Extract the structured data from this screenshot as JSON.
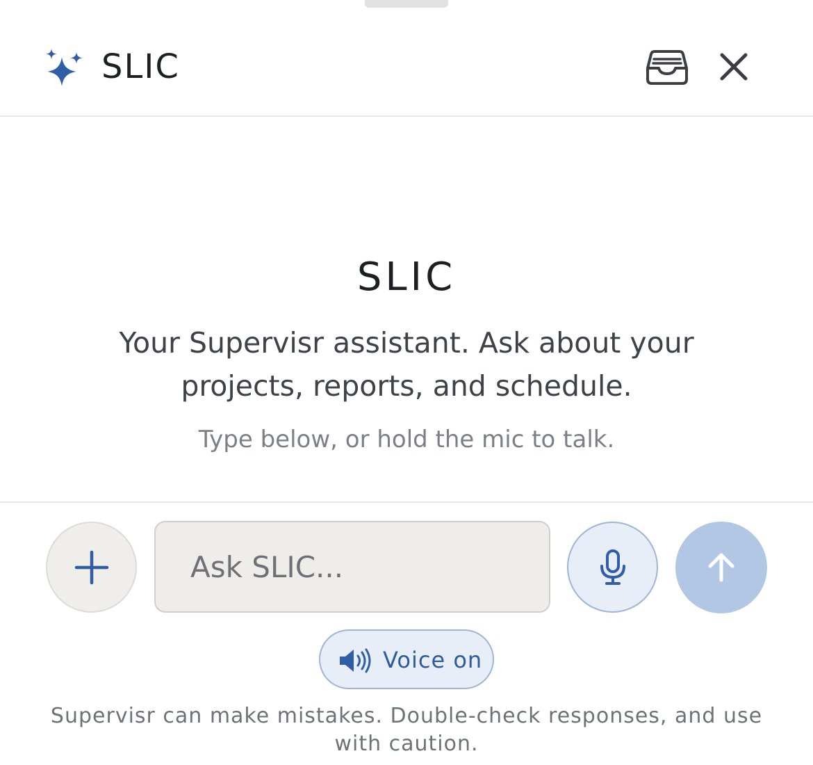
{
  "header": {
    "title": "SLIC",
    "icons": {
      "logo": "sparkles-icon",
      "inbox": "inbox-tray-icon",
      "close": "close-icon"
    },
    "accent": "#2f5ea6"
  },
  "hero": {
    "title": "SLIC",
    "description": "Your Supervisr assistant. Ask about your projects, reports, and schedule.",
    "hint": "Type below, or hold the mic to talk."
  },
  "composer": {
    "placeholder": "Ask SLIC...",
    "value": "",
    "icons": {
      "add": "plus-icon",
      "mic": "microphone-icon",
      "send": "arrow-up-icon"
    },
    "send_enabled": false
  },
  "voice": {
    "label": "Voice on",
    "icon": "speaker-icon",
    "state": "on"
  },
  "footer": {
    "disclaimer": "Supervisr can make mistakes. Double-check responses, and use with caution."
  }
}
